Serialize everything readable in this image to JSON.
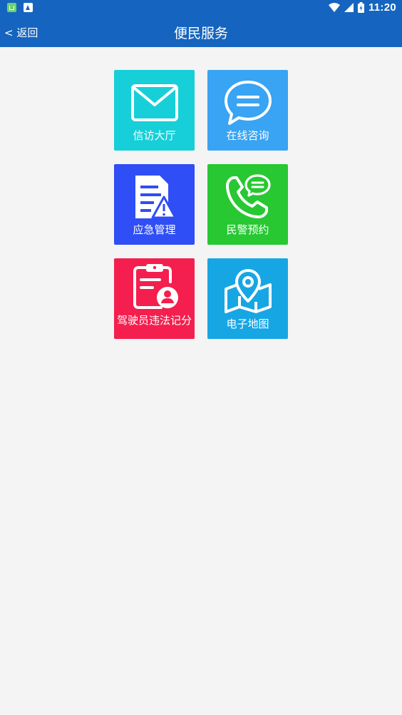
{
  "status_bar": {
    "time": "11:20",
    "icons": [
      "app-notification-icon",
      "download-notification-icon",
      "wifi-icon",
      "cell-signal-icon",
      "battery-icon"
    ]
  },
  "nav": {
    "back_label": "< 返回",
    "title": "便民服务"
  },
  "colors": {
    "primary": "#1565c0",
    "background": "#f4f4f4"
  },
  "services": [
    {
      "label": "信访大厅",
      "icon": "mail-icon",
      "color": "#17cfd8"
    },
    {
      "label": "在线咨询",
      "icon": "chat-bubble-icon",
      "color": "#39a3f4"
    },
    {
      "label": "应急管理",
      "icon": "document-warning-icon",
      "color": "#2f4ef5"
    },
    {
      "label": "民警预约",
      "icon": "phone-message-icon",
      "color": "#27c832"
    },
    {
      "label": "驾驶员违法记分",
      "icon": "clipboard-person-icon",
      "color": "#f41f4e"
    },
    {
      "label": "电子地图",
      "icon": "map-pin-icon",
      "color": "#17a6e4"
    }
  ]
}
